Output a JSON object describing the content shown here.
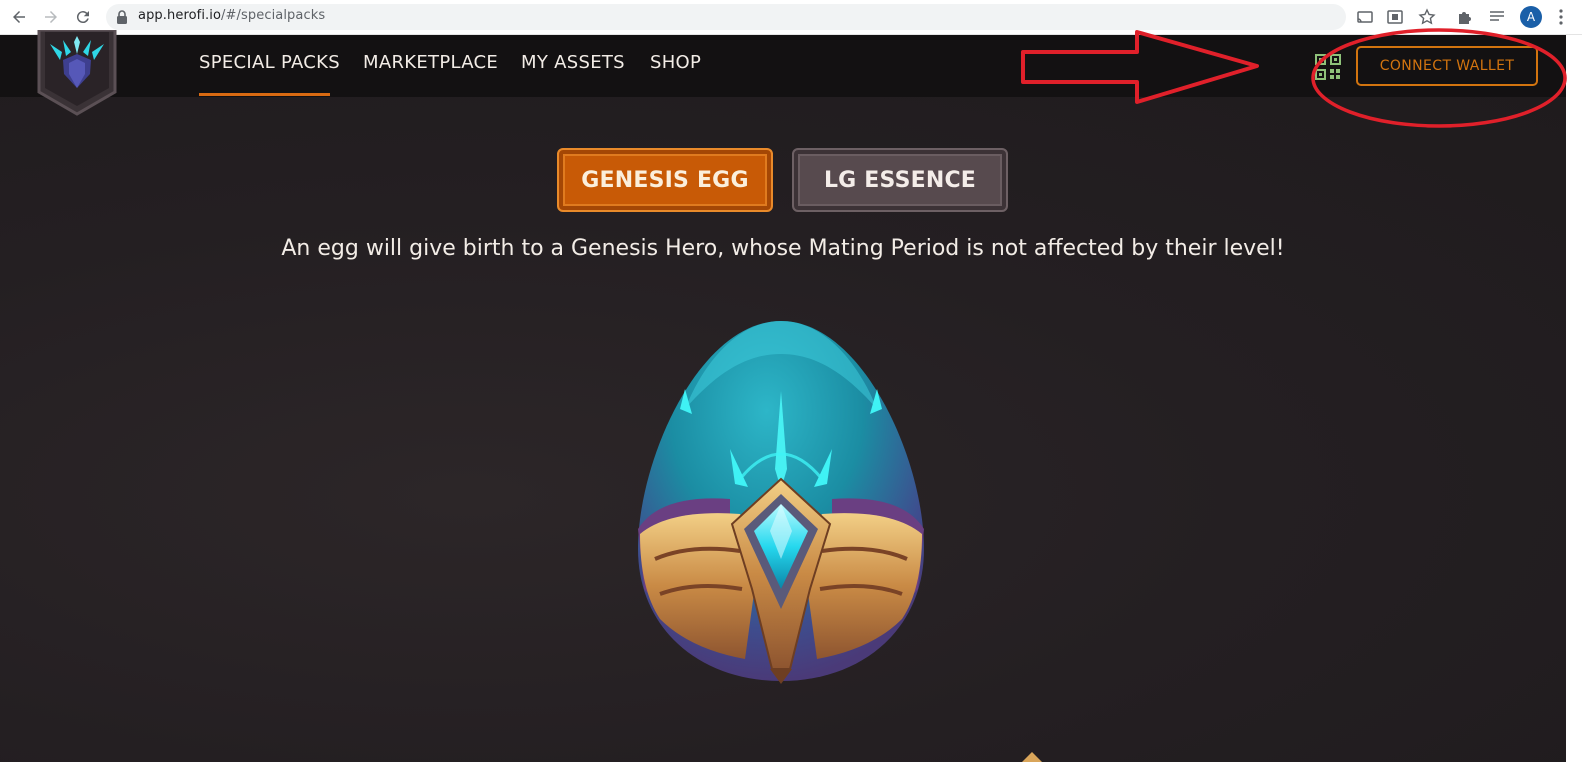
{
  "browser": {
    "url_host": "app.herofi.io",
    "url_path": "/#/specialpacks",
    "profile_initial": "A"
  },
  "nav": {
    "items": [
      {
        "label": "SPECIAL PACKS",
        "active": true
      },
      {
        "label": "MARKETPLACE",
        "active": false
      },
      {
        "label": "MY ASSETS",
        "active": false
      },
      {
        "label": "SHOP",
        "active": false
      }
    ],
    "connect_wallet_label": "CONNECT WALLET"
  },
  "packs": {
    "tabs": [
      {
        "label": "GENESIS EGG",
        "selected": true
      },
      {
        "label": "LG ESSENCE",
        "selected": false
      }
    ],
    "description": "An egg will give birth to a Genesis Hero, whose Mating Period is not affected by their level!"
  },
  "icons": {
    "back": "back-arrow-icon",
    "forward": "forward-arrow-icon",
    "reload": "reload-icon",
    "lock": "lock-icon",
    "logo": "herofi-logo-icon",
    "wallet": "qr-wallet-icon",
    "product": "genesis-egg-image"
  },
  "colors": {
    "accent": "#d2740f",
    "header_bg": "#131112",
    "stage_bg": "#241f22",
    "annotation": "#e0202a"
  }
}
